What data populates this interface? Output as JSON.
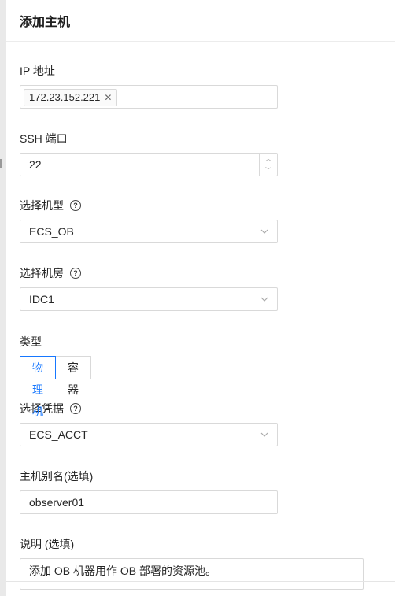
{
  "drawer": {
    "title": "添加主机"
  },
  "fields": {
    "ip": {
      "label": "IP 地址",
      "tags": [
        "172.23.152.221"
      ]
    },
    "ssh_port": {
      "label": "SSH 端口",
      "value": "22"
    },
    "machine_type": {
      "label": "选择机型",
      "value": "ECS_OB"
    },
    "idc": {
      "label": "选择机房",
      "value": "IDC1"
    },
    "type": {
      "label": "类型",
      "options": [
        "物理机",
        "容器"
      ],
      "selected": "物理机"
    },
    "credential": {
      "label": "选择凭据",
      "value": "ECS_ACCT"
    },
    "alias": {
      "label": "主机别名(选填)",
      "value": "observer01"
    },
    "description": {
      "label": "说明 (选填)",
      "value": "添加 OB 机器用作 OB 部署的资源池。"
    }
  },
  "icons": {
    "help": "question-circle-icon",
    "chevron": "chevron-down-icon",
    "close": "close-icon"
  },
  "colors": {
    "accent": "#1677ff",
    "border": "#d9d9d9"
  }
}
